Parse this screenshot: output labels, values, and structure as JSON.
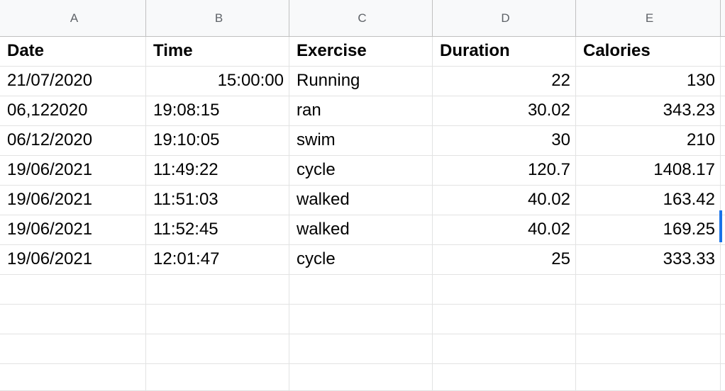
{
  "sheet": {
    "column_headers": [
      "A",
      "B",
      "C",
      "D",
      "E"
    ],
    "header_row": [
      "Date",
      "Time",
      "Exercise",
      "Duration",
      "Calories"
    ],
    "rows": [
      [
        "21/07/2020",
        "15:00:00",
        "Running",
        "22",
        "130"
      ],
      [
        "06,122020",
        "19:08:15",
        "ran",
        "30.02",
        "343.23"
      ],
      [
        "06/12/2020",
        "19:10:05",
        "swim",
        "30",
        "210"
      ],
      [
        "19/06/2021",
        "11:49:22",
        "cycle",
        "120.7",
        "1408.17"
      ],
      [
        "19/06/2021",
        "11:51:03",
        "walked",
        "40.02",
        "163.42"
      ],
      [
        "19/06/2021",
        "11:52:45",
        "walked",
        "40.02",
        "169.25"
      ],
      [
        "19/06/2021",
        "12:01:47",
        "cycle",
        "25",
        "333.33"
      ]
    ],
    "empty_rows": 4
  },
  "colors": {
    "grid_line": "#e2e3e3",
    "header_bg": "#f8f9fa",
    "header_text": "#5f6368",
    "selection": "#1a73e8"
  }
}
